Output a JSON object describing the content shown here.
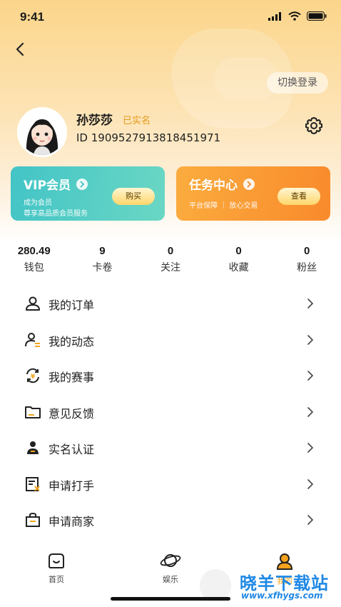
{
  "status_bar": {
    "time": "9:41"
  },
  "header": {
    "switch_login": "切换登录"
  },
  "user": {
    "name": "孙莎莎",
    "verified": "已实名",
    "id": "ID 1909527913818451971"
  },
  "cards": {
    "vip": {
      "title": "VIP会员",
      "line1": "成为会员",
      "line2": "尊享高品质会员服务",
      "button": "购买"
    },
    "task": {
      "title": "任务中心",
      "line1": "平台保障 ｜ 放心交易",
      "button": "查看"
    }
  },
  "stats": [
    {
      "value": "280.49",
      "label": "钱包"
    },
    {
      "value": "9",
      "label": "卡卷"
    },
    {
      "value": "0",
      "label": "关注"
    },
    {
      "value": "0",
      "label": "收藏"
    },
    {
      "value": "0",
      "label": "粉丝"
    }
  ],
  "menu": [
    {
      "label": "我的订单",
      "icon": "user-icon"
    },
    {
      "label": "我的动态",
      "icon": "user-list-icon"
    },
    {
      "label": "我的赛事",
      "icon": "yen-refresh-icon"
    },
    {
      "label": "意见反馈",
      "icon": "folder-icon"
    },
    {
      "label": "实名认证",
      "icon": "id-user-icon"
    },
    {
      "label": "申请打手",
      "icon": "form-edit-icon"
    },
    {
      "label": "申请商家",
      "icon": "shop-bag-icon"
    }
  ],
  "tabbar": [
    {
      "label": "首页",
      "icon": "home-icon"
    },
    {
      "label": "娱乐",
      "icon": "planet-icon"
    },
    {
      "label": "我的",
      "icon": "profile-icon"
    }
  ],
  "watermark": {
    "title": "晓羊下载站",
    "url": "www.xfhygs.com"
  },
  "colors": {
    "accent": "#f98a2c",
    "vip_gradient": [
      "#43c4c6",
      "#6ad7c4"
    ],
    "task_gradient": [
      "#fbac3e",
      "#f98a2c"
    ],
    "verified": "#e59a1a"
  }
}
